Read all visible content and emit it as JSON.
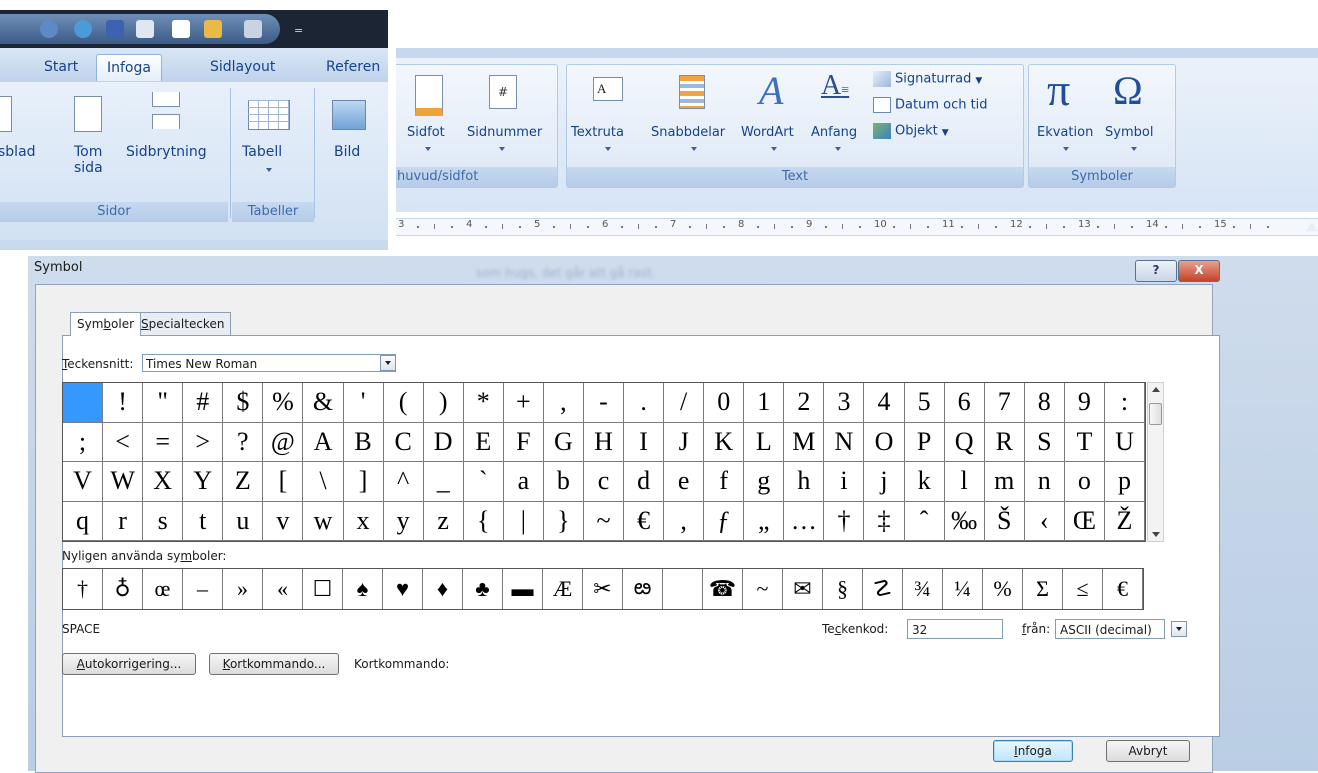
{
  "ribbon_left": {
    "tabs": [
      "Start",
      "Infoga",
      "Sidlayout",
      "Referen"
    ],
    "active_tab": "Infoga",
    "buttons": {
      "cover_page": "sblad",
      "blank_page_line1": "Tom",
      "blank_page_line2": "sida",
      "page_break": "Sidbrytning",
      "table": "Tabell",
      "picture": "Bild"
    },
    "groups": {
      "pages": "Sidor",
      "tables": "Tabeller"
    }
  },
  "ribbon_right": {
    "buttons": {
      "footer": "Sidfot",
      "page_number": "Sidnummer",
      "text_box": "Textruta",
      "quick_parts": "Snabbdelar",
      "wordart": "WordArt",
      "drop_cap": "Anfang",
      "signature_line": "Signaturrad",
      "date_time": "Datum och tid",
      "object": "Objekt",
      "equation": "Ekvation",
      "symbol": "Symbol"
    },
    "groups": {
      "header_footer": "huvud/sidfot",
      "text": "Text",
      "symbols": "Symboler"
    },
    "ruler_numbers": [
      "3",
      "4",
      "5",
      "6",
      "7",
      "8",
      "9",
      "10",
      "11",
      "12",
      "13",
      "14",
      "15"
    ]
  },
  "dialog": {
    "title": "Symbol",
    "background_text": "som hugs, det går att gå rast.",
    "help_glyph": "?",
    "close_glyph": "X",
    "tabs": {
      "symbols_pre": "Sym",
      "symbols_u": "b",
      "symbols_post": "oler",
      "special_u": "S",
      "special_post": "pecialtecken"
    },
    "font_label_u": "T",
    "font_label_post": "eckensnitt:",
    "font_value": "Times New Roman",
    "symbol_grid": [
      " ",
      "!",
      "\"",
      "#",
      "$",
      "%",
      "&",
      "'",
      "(",
      ")",
      "*",
      "+",
      ",",
      "-",
      ".",
      "/",
      "0",
      "1",
      "2",
      "3",
      "4",
      "5",
      "6",
      "7",
      "8",
      "9",
      ":",
      ";",
      "<",
      "=",
      ">",
      "?",
      "@",
      "A",
      "B",
      "C",
      "D",
      "E",
      "F",
      "G",
      "H",
      "I",
      "J",
      "K",
      "L",
      "M",
      "N",
      "O",
      "P",
      "Q",
      "R",
      "S",
      "T",
      "U",
      "V",
      "W",
      "X",
      "Y",
      "Z",
      "[",
      "\\",
      "]",
      "^",
      "_",
      "`",
      "a",
      "b",
      "c",
      "d",
      "e",
      "f",
      "g",
      "h",
      "i",
      "j",
      "k",
      "l",
      "m",
      "n",
      "o",
      "p",
      "q",
      "r",
      "s",
      "t",
      "u",
      "v",
      "w",
      "x",
      "y",
      "z",
      "{",
      "|",
      "}",
      "~",
      "€",
      ",",
      "ƒ",
      "„",
      "…",
      "†",
      "‡",
      "ˆ",
      "‰",
      "Š",
      "‹",
      "Œ",
      "Ž"
    ],
    "selected_index": 0,
    "recent_label_pre": "Nyligen använda sy",
    "recent_label_u": "m",
    "recent_label_post": "boler:",
    "recent_symbols": [
      "†",
      "♁",
      "œ",
      "–",
      "»",
      "«",
      "☐",
      "♠",
      "♥",
      "♦",
      "♣",
      "▬",
      "Æ",
      "✂",
      "ఴ",
      " ",
      "☎",
      "~",
      "✉",
      "§",
      "☡",
      "¾",
      "¼",
      "%",
      "Σ",
      "≤",
      "€"
    ],
    "char_name": "SPACE",
    "charcode_label_pre": "Te",
    "charcode_label_u": "c",
    "charcode_label_post": "kenkod:",
    "charcode_value": "32",
    "from_label_u": "f",
    "from_label_post": "rån:",
    "from_value": "ASCII (decimal)",
    "autocorrect_u": "A",
    "autocorrect_post": "utokorrigering...",
    "shortcut_u": "K",
    "shortcut_post": "ortkommando...",
    "shortcut_label": "Kortkommando:",
    "insert_u": "I",
    "insert_post": "nfoga",
    "cancel": "Avbryt"
  }
}
